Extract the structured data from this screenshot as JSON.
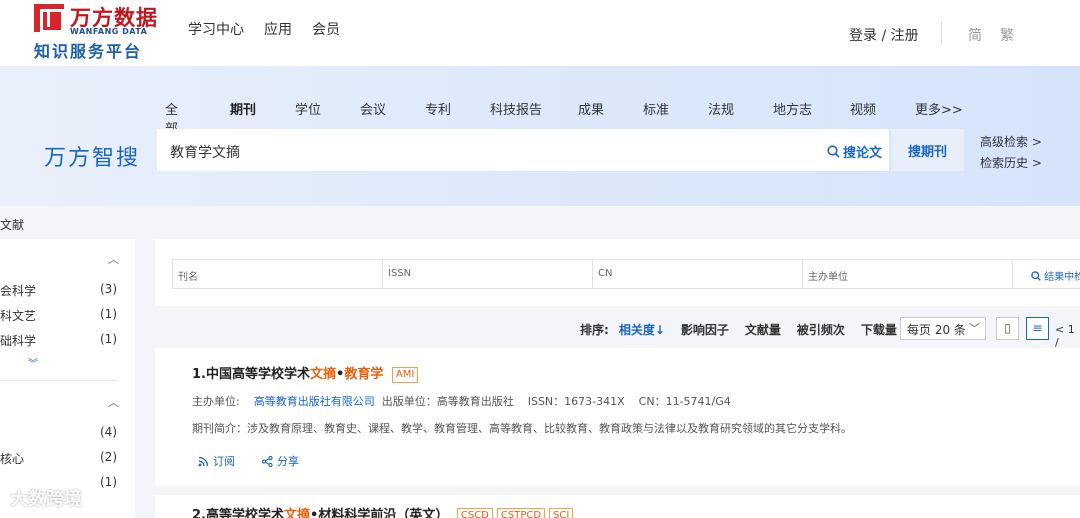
{
  "header": {
    "logo_cn": "万方数据",
    "logo_en": "WANFANG DATA",
    "logo_sub": "知识服务平台",
    "nav": [
      "学习中心",
      "应用",
      "会员"
    ],
    "login": "登录 / 注册",
    "lang": [
      "简",
      "繁"
    ]
  },
  "search": {
    "brand": "万方智搜",
    "categories": [
      "全部",
      "期刊",
      "学位",
      "会议",
      "专利",
      "科技报告",
      "成果",
      "标准",
      "法规",
      "地方志",
      "视频",
      "更多>>"
    ],
    "active_category": "期刊",
    "query": "教育学文摘",
    "search_paper_label": "搜论文",
    "search_journal_label": "搜期刊",
    "advanced": "高级检索 >",
    "history": "检索历史 >"
  },
  "breadcrumb": "文献",
  "sidebar": {
    "group1": [
      {
        "label": "会科学",
        "count": "(3)"
      },
      {
        "label": "科文艺",
        "count": "(1)"
      },
      {
        "label": "础科学",
        "count": "(1)"
      }
    ],
    "group2": [
      {
        "label": "",
        "count": "(4)"
      },
      {
        "label": "核心",
        "count": "(2)"
      },
      {
        "label": "",
        "count": "(1)"
      }
    ]
  },
  "filter": {
    "fields": [
      "刊名",
      "ISSN",
      "CN",
      "主办单位"
    ],
    "search_within": "结果中检"
  },
  "sort": {
    "label": "排序:",
    "options": [
      "相关度↓",
      "影响因子",
      "文献量",
      "被引频次",
      "下载量"
    ],
    "per_page": "每页 20 条",
    "pager": "< 1 /"
  },
  "results": [
    {
      "index": "1.",
      "title_parts": [
        "中国高等学校学术",
        "文摘",
        "•",
        "教育学"
      ],
      "tags": [
        "AMI"
      ],
      "meta": {
        "sponsor_label": "主办单位:",
        "sponsor": "高等教育出版社有限公司",
        "publisher": "出版单位：高等教育出版社",
        "issn": "ISSN：1673-341X",
        "cn": "CN：11-5741/G4"
      },
      "desc": "期刊简介：涉及教育原理、教育史、课程、教学、教育管理、高等教育、比较教育、教育政策与法律以及教育研究领域的其它分支学科。",
      "subscribe": "订阅",
      "share": "分享"
    },
    {
      "index": "2.",
      "title_parts": [
        "高等学校学术",
        "文摘",
        "•材料科学前沿（英文）"
      ],
      "tags": [
        "CSCD",
        "CSTPCD",
        "SCI"
      ]
    }
  ],
  "watermark": "大数跨境"
}
